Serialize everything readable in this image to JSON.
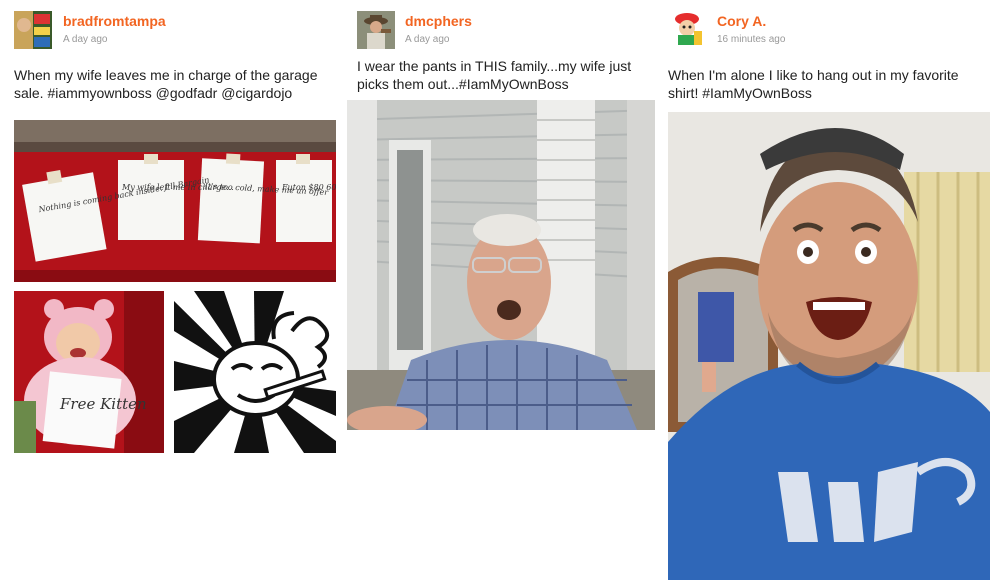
{
  "posts": [
    {
      "username": "bradfromtampa",
      "time": "A day ago",
      "caption": "When my wife leaves me in charge of the garage sale. #iammyownboss @godfadr @cigardojo",
      "signs": [
        "Nothing is coming back inside. I'll Bargain",
        "My wife left me in charge...",
        "It's too cold, make me an offer",
        "Futon $80 60"
      ],
      "kitten_sign": "Free Kitten"
    },
    {
      "username": "dmcphers",
      "time": "A day ago",
      "caption": "I wear the pants in THIS family...my wife just picks them out...#IamMyOwnBoss"
    },
    {
      "username": "Cory A.",
      "time": "16 minutes ago",
      "caption": "When I'm alone I like to hang out in my favorite shirt! #IamMyOwnBoss"
    }
  ],
  "colors": {
    "username": "#f26522",
    "timestamp": "#999999"
  }
}
